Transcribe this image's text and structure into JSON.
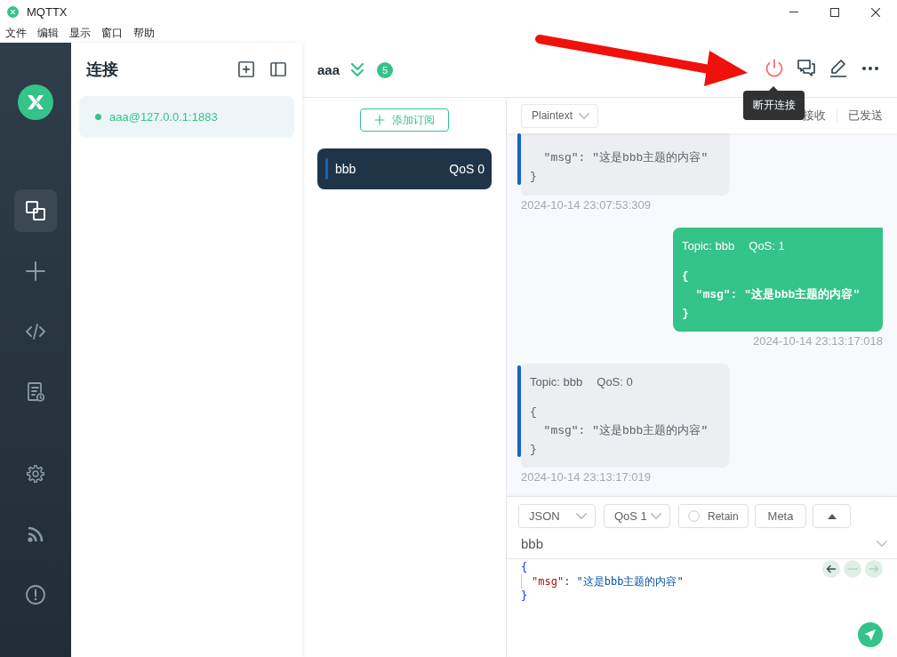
{
  "window": {
    "title": "MQTTX"
  },
  "menu": [
    {
      "label": "文件"
    },
    {
      "label": "编辑"
    },
    {
      "label": "显示"
    },
    {
      "label": "窗口"
    },
    {
      "label": "帮助"
    }
  ],
  "nav": {
    "top": [
      {
        "kind": "connections",
        "selected": true
      },
      {
        "kind": "new",
        "selected": false
      },
      {
        "kind": "script",
        "selected": false
      },
      {
        "kind": "log",
        "selected": false
      }
    ],
    "bottom": [
      {
        "kind": "settings",
        "selected": false
      },
      {
        "kind": "feed",
        "selected": false
      },
      {
        "kind": "about",
        "selected": false
      }
    ]
  },
  "connections_panel": {
    "title": "连接",
    "connections": [
      {
        "name": "aaa@127.0.0.1:1883",
        "connected": true,
        "selected": true
      }
    ]
  },
  "header": {
    "name": "aaa",
    "unread": "5",
    "tooltip": "断开连接"
  },
  "subscriptions": {
    "add_label": "添加订阅",
    "items": [
      {
        "topic": "bbb",
        "qos": "QoS 0",
        "color": "#1565c0",
        "selected": true
      }
    ]
  },
  "message_toolbar": {
    "format": "Plaintext",
    "tabs": [
      {
        "label": "接收",
        "selected": false
      },
      {
        "label": "已发送",
        "selected": false
      }
    ]
  },
  "messages": [
    {
      "kind": "received",
      "clipped": true,
      "color": "#1565c0",
      "payload": "  \"msg\": \"这是bbb主题的内容\"\n}",
      "time": "2024-10-14 23:07:53:309"
    },
    {
      "kind": "sent",
      "clipped": false,
      "topic": "Topic: bbb",
      "qos": "QoS: 1",
      "payload": "{\n  \"msg\": \"这是bbb主题的内容\"\n}",
      "time": "2024-10-14 23:13:17:018"
    },
    {
      "kind": "received",
      "clipped": false,
      "color": "#1565c0",
      "topic": "Topic: bbb",
      "qos": "QoS: 0",
      "payload": "{\n  \"msg\": \"这是bbb主题的内容\"\n}",
      "time": "2024-10-14 23:13:17:019"
    }
  ],
  "composer": {
    "format": "JSON",
    "qos": "QoS 1",
    "retain": {
      "label": "Retain",
      "checked": false
    },
    "meta": "Meta",
    "topic": "bbb",
    "editor": {
      "lines": [
        {
          "indented": false,
          "tokens": [
            {
              "kind": "bracket",
              "text": "{"
            }
          ]
        },
        {
          "indented": true,
          "tokens": [
            {
              "kind": "key",
              "text": "\"msg\""
            },
            {
              "kind": "punct",
              "text": ": "
            },
            {
              "kind": "string",
              "text": "\"这是bbb主题的内容\""
            }
          ]
        },
        {
          "indented": false,
          "tokens": [
            {
              "kind": "bracket",
              "text": "}"
            }
          ]
        }
      ]
    },
    "history": [
      {
        "kind": "back",
        "disabled": false
      },
      {
        "kind": "clear",
        "disabled": true
      },
      {
        "kind": "forward",
        "disabled": true
      }
    ]
  }
}
